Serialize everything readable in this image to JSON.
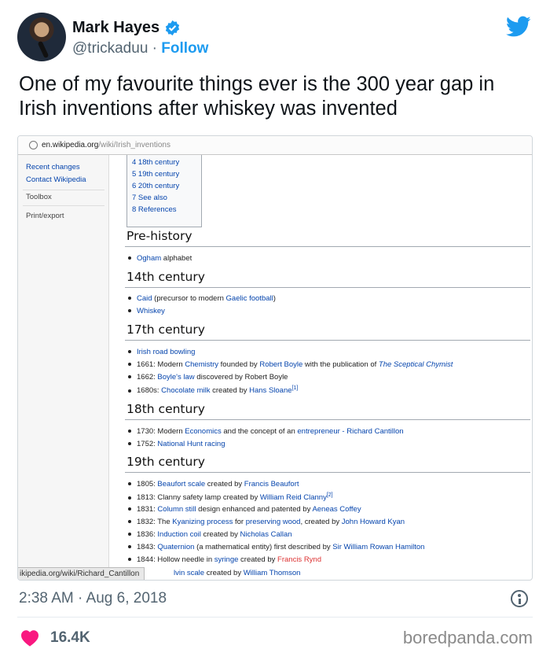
{
  "author": {
    "name": "Mark Hayes",
    "handle": "@trickaduu",
    "separator": "·",
    "follow_label": "Follow"
  },
  "tweet": {
    "text": "One of my favourite things ever is the 300 year gap in Irish inventions after whiskey was invented"
  },
  "screenshot": {
    "url_host": "en.wikipedia.org",
    "url_path": "/wiki/Irish_inventions",
    "sidebar": {
      "recent_changes": "Recent changes",
      "contact": "Contact Wikipedia",
      "toolbox": "Toolbox",
      "print": "Print/export"
    },
    "toc": [
      "4 18th century",
      "5 19th century",
      "6 20th century",
      "7 See also",
      "8 References"
    ],
    "sections": {
      "prehistory": "Pre-history",
      "c14": "14th century",
      "c17": "17th century",
      "c18": "18th century",
      "c19": "19th century"
    },
    "items": {
      "ogham_link": "Ogham",
      "ogham_rest": " alphabet",
      "caid_link": "Caid",
      "caid_mid": " (precursor to modern ",
      "caid_link2": "Gaelic football",
      "caid_end": ")",
      "whiskey": "Whiskey",
      "road_bowling": "Irish road bowling",
      "i1661_a": "1661: Modern ",
      "i1661_l1": "Chemistry",
      "i1661_b": " founded by ",
      "i1661_l2": "Robert Boyle",
      "i1661_c": " with the publication of ",
      "i1661_l3": "The Sceptical Chymist",
      "i1662_a": "1662: ",
      "i1662_l": "Boyle's law",
      "i1662_b": " discovered by Robert Boyle",
      "i1680_a": "1680s: ",
      "i1680_l": "Chocolate milk",
      "i1680_b": " created by ",
      "i1680_l2": "Hans Sloane",
      "i1680_sup": "[1]",
      "i1730_a": "1730: Modern ",
      "i1730_l": "Economics",
      "i1730_b": " and the concept of an ",
      "i1730_l2": "entrepreneur - Richard Cantillon",
      "i1752_a": "1752: ",
      "i1752_l": "National Hunt racing",
      "i1805_a": "1805: ",
      "i1805_l": "Beaufort scale",
      "i1805_b": " created by ",
      "i1805_l2": "Francis Beaufort",
      "i1813_a": "1813: Clanny safety lamp created by ",
      "i1813_l": "William Reid Clanny",
      "i1813_sup": "[2]",
      "i1831_a": "1831: ",
      "i1831_l": "Column still",
      "i1831_b": " design enhanced and patented by ",
      "i1831_l2": "Aeneas Coffey",
      "i1832_a": "1832: The ",
      "i1832_l": "Kyanizing process",
      "i1832_b": " for ",
      "i1832_l2": "preserving wood",
      "i1832_c": ", created by ",
      "i1832_l3": "John Howard Kyan",
      "i1836_a": "1836: ",
      "i1836_l": "Induction coil",
      "i1836_b": " created by ",
      "i1836_l2": "Nicholas Callan",
      "i1843_a": "1843: ",
      "i1843_l": "Quaternion",
      "i1843_b": " (a mathematical entity) first described by ",
      "i1843_l2": "Sir William Rowan Hamilton",
      "i1844_a": "1844: Hollow needle in ",
      "i1844_l": "syringe",
      "i1844_b": " created by ",
      "i1844_l2": "Francis Rynd",
      "last_l": "lvin scale",
      "last_b": " created by ",
      "last_l2": "William Thomson"
    },
    "status_url": "ikipedia.org/wiki/Richard_Cantillon"
  },
  "meta": {
    "time": "2:38 AM · Aug 6, 2018",
    "likes": "16.4K",
    "source": "boredpanda.com"
  },
  "colors": {
    "twitter_blue": "#1d9bf0",
    "heart": "#f91880",
    "link": "#0645ad",
    "redlink": "#d33"
  },
  "icons": [
    "verified-badge-icon",
    "twitter-bird-icon",
    "info-icon",
    "heart-icon",
    "globe-icon"
  ]
}
